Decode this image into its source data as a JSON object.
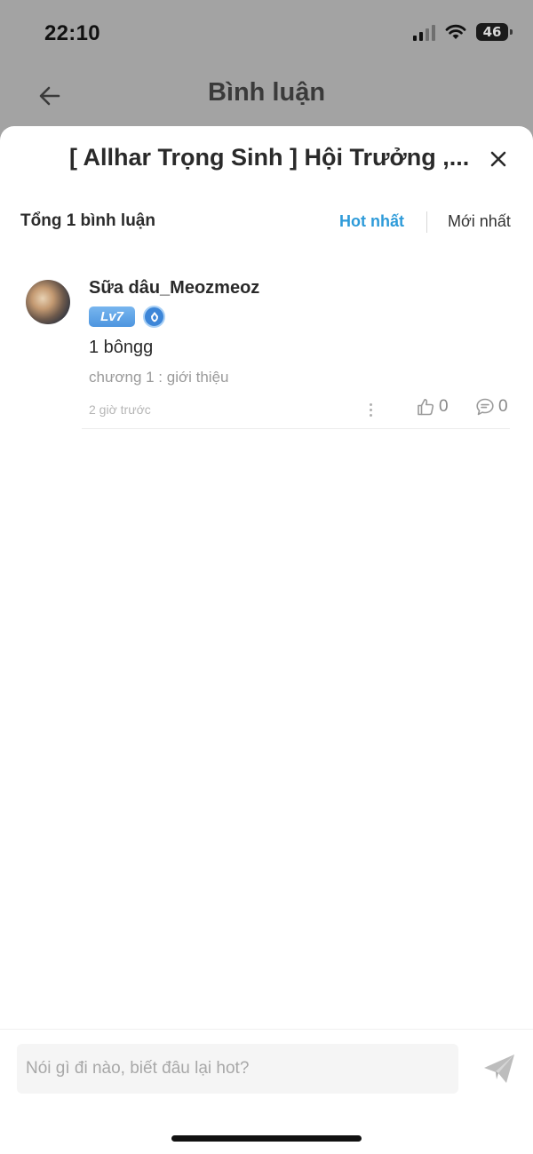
{
  "status_bar": {
    "time": "22:10",
    "battery": "46"
  },
  "header": {
    "title": "Bình luận",
    "back_icon": "arrow-left-icon"
  },
  "sheet": {
    "title": "[ Allhar Trọng Sinh ] Hội Trưởng ,...",
    "close_icon": "close-icon"
  },
  "summary": {
    "total": "Tổng 1 bình luận",
    "sort_hot": "Hot nhất",
    "sort_new": "Mới nhất",
    "active_sort_color": "#2e9bd9"
  },
  "comments": [
    {
      "username": "Sữa dâu_Meozmeoz",
      "level": "Lv7",
      "text": "1 bôngg",
      "chapter": "chương 1 : giới thiệu",
      "time": "2 giờ trước",
      "likes": "0",
      "replies": "0"
    }
  ],
  "input": {
    "placeholder": "Nói gì đi nào, biết đâu lại hot?",
    "send_icon": "send-icon"
  },
  "colors": {
    "accent": "#2e9bd9",
    "level_badge": "#5a9fe4"
  }
}
